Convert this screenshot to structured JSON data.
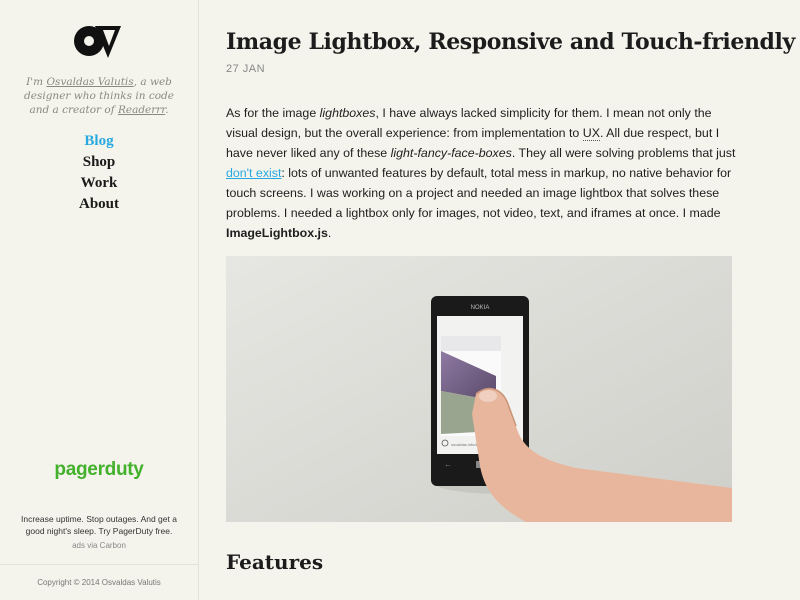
{
  "sidebar": {
    "intro": {
      "prefix": "I'm ",
      "author_link": "Osvaldas Valutis",
      "middle": ", a web designer who thinks in code and a creator of ",
      "product_link": "Readerrr",
      "suffix": "."
    },
    "nav": [
      {
        "label": "Blog",
        "active": true
      },
      {
        "label": "Shop",
        "active": false
      },
      {
        "label": "Work",
        "active": false
      },
      {
        "label": "About",
        "active": false
      }
    ],
    "ad": {
      "brand": "pagerduty",
      "text": "Increase uptime. Stop outages. And get a good night's sleep. Try PagerDuty free.",
      "via": "ads via Carbon"
    },
    "copyright": "Copyright © 2014 Osvaldas Valutis"
  },
  "post": {
    "title": "Image Lightbox, Responsive and Touch-friendly",
    "date": "27 JAN",
    "p1_a": "As for the image ",
    "p1_em1": "lightboxes",
    "p1_b": ", I have always lacked simplicity for them. I mean not only the visual design, but the overall experience: from implementation to ",
    "p1_abbr": "UX",
    "p1_c": ". All due respect, but I have never liked any of these ",
    "p1_em2": "light-fancy-face-boxes",
    "p1_d": ". They all were solving problems that just ",
    "p1_link": "don't exist",
    "p1_e": ": lots of unwanted features by default, total mess in markup, no native behavior for touch screens. I was working on a project and needed an image lightbox that solves these problems. I needed a lightbox only for images, not video, text, and iframes at once. I made ",
    "p1_strong": "ImageLightbox.js",
    "p1_f": ".",
    "features_heading": "Features",
    "hero_phone_brand": "NOKIA"
  }
}
